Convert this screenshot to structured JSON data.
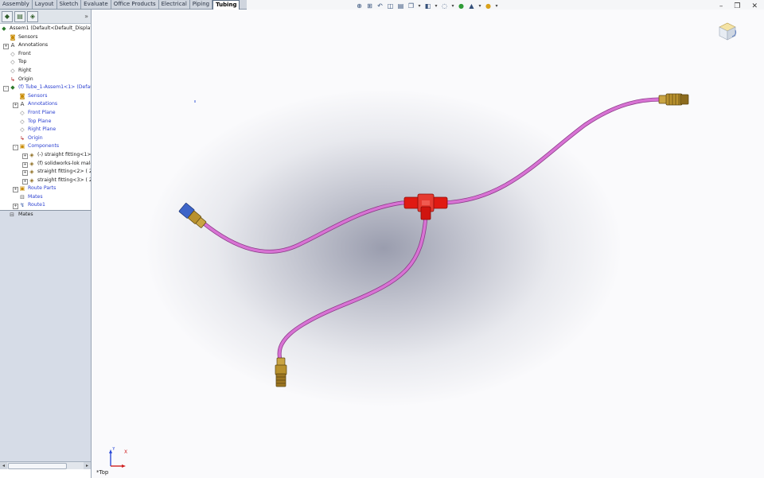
{
  "command_tabs": [
    {
      "label": "Assembly",
      "active": false
    },
    {
      "label": "Layout",
      "active": false
    },
    {
      "label": "Sketch",
      "active": false
    },
    {
      "label": "Evaluate",
      "active": false
    },
    {
      "label": "Office Products",
      "active": false
    },
    {
      "label": "Electrical",
      "active": false
    },
    {
      "label": "Piping",
      "active": false
    },
    {
      "label": "Tubing",
      "active": true
    }
  ],
  "view_toolbar": [
    "zoom-to-fit-icon",
    "zoom-to-area-icon",
    "previous-view-icon",
    "section-view-icon",
    "dynamic-annotation-icon",
    "view-orientation-icon",
    "display-style-icon",
    "hide-show-icon",
    "edit-appearance-icon",
    "apply-scene-icon",
    "view-settings-icon"
  ],
  "window_controls": [
    "minimize-icon",
    "restore-icon",
    "close-icon"
  ],
  "panel_tabs": [
    "featuremanager-icon",
    "propertymanager-icon",
    "configurationmanager-icon"
  ],
  "filter_symbol": "▼",
  "tree": {
    "root": "Assem1  (Default<Default_Display S",
    "items": [
      {
        "label": "Sensors",
        "indent": 1,
        "expand": "",
        "icon": "sensor-icon",
        "blue": false
      },
      {
        "label": "Annotations",
        "indent": 1,
        "expand": "+",
        "icon": "annotation-icon",
        "blue": false
      },
      {
        "label": "Front",
        "indent": 1,
        "expand": "",
        "icon": "plane-icon",
        "blue": false
      },
      {
        "label": "Top",
        "indent": 1,
        "expand": "",
        "icon": "plane-icon",
        "blue": false
      },
      {
        "label": "Right",
        "indent": 1,
        "expand": "",
        "icon": "plane-icon",
        "blue": false
      },
      {
        "label": "Origin",
        "indent": 1,
        "expand": "",
        "icon": "origin-icon",
        "blue": false
      },
      {
        "label": "(f) Tube_1-Assem1<1> (Default",
        "indent": 1,
        "expand": "-",
        "icon": "subassembly-icon",
        "blue": true
      },
      {
        "label": "Sensors",
        "indent": 2,
        "expand": "",
        "icon": "sensor-icon",
        "blue": true
      },
      {
        "label": "Annotations",
        "indent": 2,
        "expand": "+",
        "icon": "annotation-icon",
        "blue": true
      },
      {
        "label": "Front Plane",
        "indent": 2,
        "expand": "",
        "icon": "plane-icon",
        "blue": true
      },
      {
        "label": "Top Plane",
        "indent": 2,
        "expand": "",
        "icon": "plane-icon",
        "blue": true
      },
      {
        "label": "Right Plane",
        "indent": 2,
        "expand": "",
        "icon": "plane-icon",
        "blue": true
      },
      {
        "label": "Origin",
        "indent": 2,
        "expand": "",
        "icon": "origin-icon",
        "blue": true
      },
      {
        "label": "Components",
        "indent": 2,
        "expand": "-",
        "icon": "folder-icon",
        "blue": true
      },
      {
        "label": "(-) straight fitting<1> (",
        "indent": 3,
        "expand": "+",
        "icon": "part-icon",
        "blue": false
      },
      {
        "label": "(f) solidworks-lok male b",
        "indent": 3,
        "expand": "+",
        "icon": "part-icon",
        "blue": false
      },
      {
        "label": "straight fitting<2> ( 25",
        "indent": 3,
        "expand": "+",
        "icon": "part-icon",
        "blue": false
      },
      {
        "label": "straight fitting<3> ( 25",
        "indent": 3,
        "expand": "+",
        "icon": "part-icon",
        "blue": false
      },
      {
        "label": "Route Parts",
        "indent": 2,
        "expand": "+",
        "icon": "folder-icon",
        "blue": true
      },
      {
        "label": "Mates",
        "indent": 2,
        "expand": "",
        "icon": "mates-icon",
        "blue": true
      },
      {
        "label": "Route1",
        "indent": 2,
        "expand": "+",
        "icon": "route-icon",
        "blue": true
      }
    ],
    "mates_label": "Mates"
  },
  "viewport": {
    "view_label": "*Top",
    "triad_x": "X",
    "triad_y": "Y",
    "tube_color": "#d873d4",
    "tee_color": "#e01a12",
    "fitting_color": "#b8912e",
    "nut_color": "#3d64c8"
  }
}
